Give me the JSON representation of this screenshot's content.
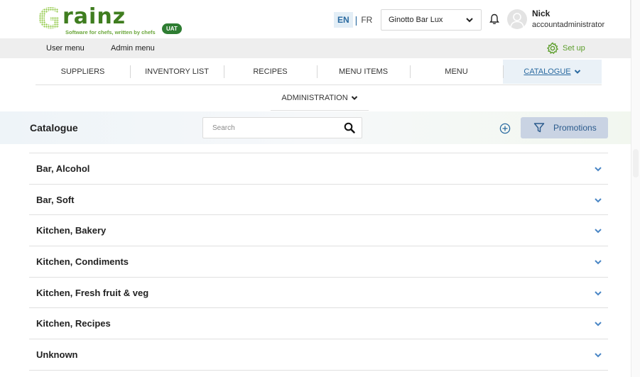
{
  "app": {
    "logo_letter": "G",
    "logo_word": "rainz",
    "tagline": "Software for chefs, written by chefs",
    "env_badge": "UAT"
  },
  "header": {
    "lang_en": "EN",
    "lang_sep": "|",
    "lang_fr": "FR",
    "venue": "Ginotto Bar Lux",
    "user_name": "Nick",
    "user_role": "accountadministrator"
  },
  "subbar": {
    "user_menu": "User menu",
    "admin_menu": "Admin menu",
    "setup": "Set up"
  },
  "nav": {
    "items": [
      {
        "label": "SUPPLIERS"
      },
      {
        "label": "INVENTORY LIST"
      },
      {
        "label": "RECIPES"
      },
      {
        "label": "MENU ITEMS"
      },
      {
        "label": "MENU"
      },
      {
        "label": "CATALOGUE",
        "active": true
      }
    ],
    "administration": "ADMINISTRATION"
  },
  "toolbar": {
    "title": "Catalogue",
    "search_placeholder": "Search",
    "promotions_label": "Promotions"
  },
  "categories": [
    {
      "label": "Bar, Alcohol"
    },
    {
      "label": "Bar, Soft"
    },
    {
      "label": "Kitchen, Bakery"
    },
    {
      "label": "Kitchen, Condiments"
    },
    {
      "label": "Kitchen, Fresh fruit & veg"
    },
    {
      "label": "Kitchen, Recipes"
    },
    {
      "label": "Unknown"
    }
  ],
  "colors": {
    "brand_green": "#3f7d1f",
    "link_blue": "#2a6aa0",
    "promo_bg": "#c9d3e3"
  }
}
